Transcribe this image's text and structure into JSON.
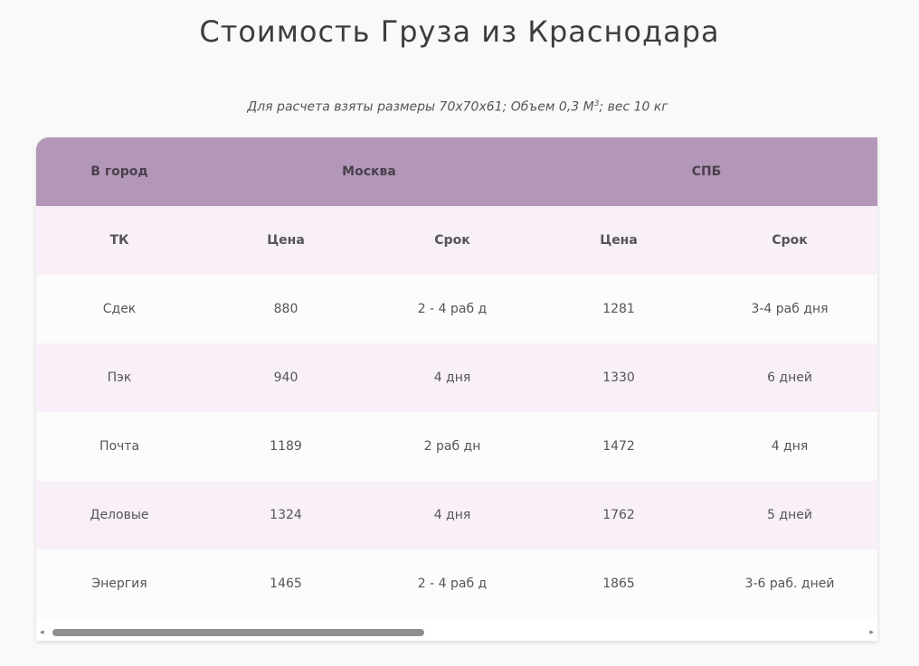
{
  "title": "Стоимость Груза из Краснодара",
  "subtitle": {
    "text": "Для расчета взяты размеры 70х70х61; Объем 0,3 М",
    "superscript": "3",
    "suffix": "; вес 10 кг"
  },
  "table": {
    "header": {
      "city_label": "В город",
      "moscow": "Москва",
      "spb": "СПБ"
    },
    "columns": [
      "ТК",
      "Цена",
      "Срок",
      "Цена",
      "Срок"
    ],
    "rows": [
      [
        "Сдек",
        "880",
        "2 - 4 раб д",
        "1281",
        "3-4 раб дня"
      ],
      [
        "Пэк",
        "940",
        "4 дня",
        "1330",
        "6 дней"
      ],
      [
        "Почта",
        "1189",
        "2 раб дн",
        "1472",
        "4 дня"
      ],
      [
        "Деловые",
        "1324",
        "4 дня",
        "1762",
        "5 дней"
      ],
      [
        "Энергия",
        "1465",
        "2 - 4 раб д",
        "1865",
        "3-6 раб. дней"
      ]
    ]
  },
  "scrollbar": {
    "left_arrow": "◂",
    "right_arrow": "▸"
  }
}
